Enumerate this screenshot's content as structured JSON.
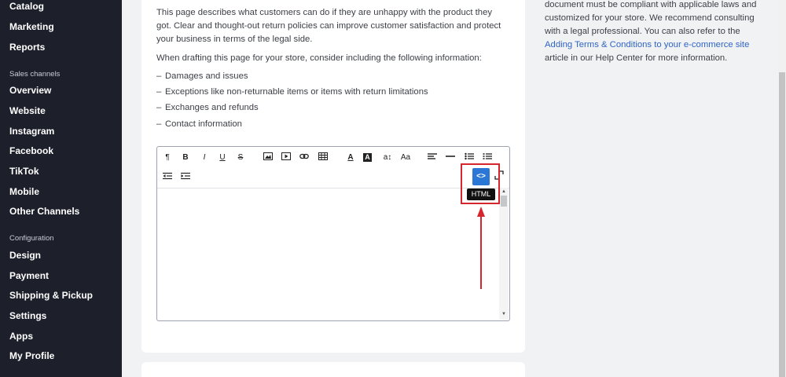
{
  "sidebar": {
    "items": [
      {
        "label": "Catalog"
      },
      {
        "label": "Marketing"
      },
      {
        "label": "Reports"
      },
      {
        "label": "Overview"
      },
      {
        "label": "Website"
      },
      {
        "label": "Instagram"
      },
      {
        "label": "Facebook"
      },
      {
        "label": "TikTok"
      },
      {
        "label": "Mobile"
      },
      {
        "label": "Other Channels"
      },
      {
        "label": "Design"
      },
      {
        "label": "Payment"
      },
      {
        "label": "Shipping & Pickup"
      },
      {
        "label": "Settings"
      },
      {
        "label": "Apps"
      },
      {
        "label": "My Profile"
      }
    ],
    "sections": {
      "sales_channels": "Sales channels",
      "configuration": "Configuration"
    }
  },
  "main": {
    "paragraph1": "This page describes what customers can do if they are unhappy with the product they got. Clear and thought-out return policies can improve customer satisfaction and protect your business in terms of the legal side.",
    "paragraph2": "When drafting this page for your store, consider including the following information:",
    "bullets": [
      "Damages and issues",
      "Exceptions like non-returnable items or items with return limitations",
      "Exchanges and refunds",
      "Contact information"
    ],
    "bullet_dash": "–"
  },
  "editor": {
    "toolbar": {
      "paragraph": "¶",
      "bold": "B",
      "italic": "I",
      "underline": "U",
      "strike": "S",
      "font_size": "a↕",
      "font_family": "Aa",
      "text_color": "A",
      "highlight": "A",
      "html": "<>",
      "html_tooltip": "HTML"
    }
  },
  "side_info": {
    "text1": "document must be compliant with applicable laws and customized for your store. We recommend consulting with a legal professional. You can also refer to the ",
    "link": "Adding Terms & Conditions to your e-commerce site",
    "text2": " article in our Help Center for more information."
  },
  "colors": {
    "sidebar_bg": "#1d202b",
    "accent": "#2b77d6",
    "annotation": "#d6262d",
    "link": "#2f64c6"
  }
}
